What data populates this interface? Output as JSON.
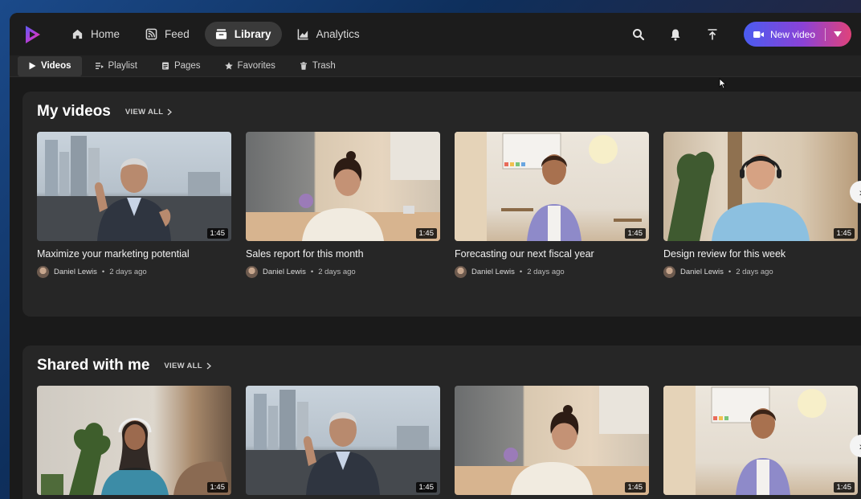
{
  "topbar": {
    "nav": [
      {
        "label": "Home",
        "icon": "home-icon"
      },
      {
        "label": "Feed",
        "icon": "feed-icon"
      },
      {
        "label": "Library",
        "icon": "library-icon",
        "active": true
      },
      {
        "label": "Analytics",
        "icon": "analytics-icon"
      }
    ],
    "new_video_label": "New video"
  },
  "subnav": [
    {
      "label": "Videos",
      "icon": "play-icon",
      "active": true
    },
    {
      "label": "Playlist",
      "icon": "playlist-icon"
    },
    {
      "label": "Pages",
      "icon": "pages-icon"
    },
    {
      "label": "Favorites",
      "icon": "star-icon"
    },
    {
      "label": "Trash",
      "icon": "trash-icon"
    }
  ],
  "sections": [
    {
      "title": "My videos",
      "view_all": "VIEW ALL",
      "videos": [
        {
          "title": "Maximize your marketing potential",
          "author": "Daniel Lewis",
          "time": "2 days ago",
          "duration": "1:45"
        },
        {
          "title": "Sales report for this month",
          "author": "Daniel Lewis",
          "time": "2 days ago",
          "duration": "1:45"
        },
        {
          "title": "Forecasting our next fiscal year",
          "author": "Daniel Lewis",
          "time": "2 days ago",
          "duration": "1:45"
        },
        {
          "title": "Design review for this week",
          "author": "Daniel Lewis",
          "time": "2 days ago",
          "duration": "1:45"
        }
      ]
    },
    {
      "title": "Shared with me",
      "view_all": "VIEW ALL",
      "videos": [
        {
          "duration": "1:45"
        },
        {
          "duration": "1:45"
        },
        {
          "duration": "1:45"
        },
        {
          "duration": "1:45"
        }
      ]
    }
  ],
  "colors": {
    "accent_gradient": [
      "#4a5cf0",
      "#8b42d6",
      "#e0427a"
    ],
    "background": "#1a1a1a",
    "panel": "#262626"
  }
}
